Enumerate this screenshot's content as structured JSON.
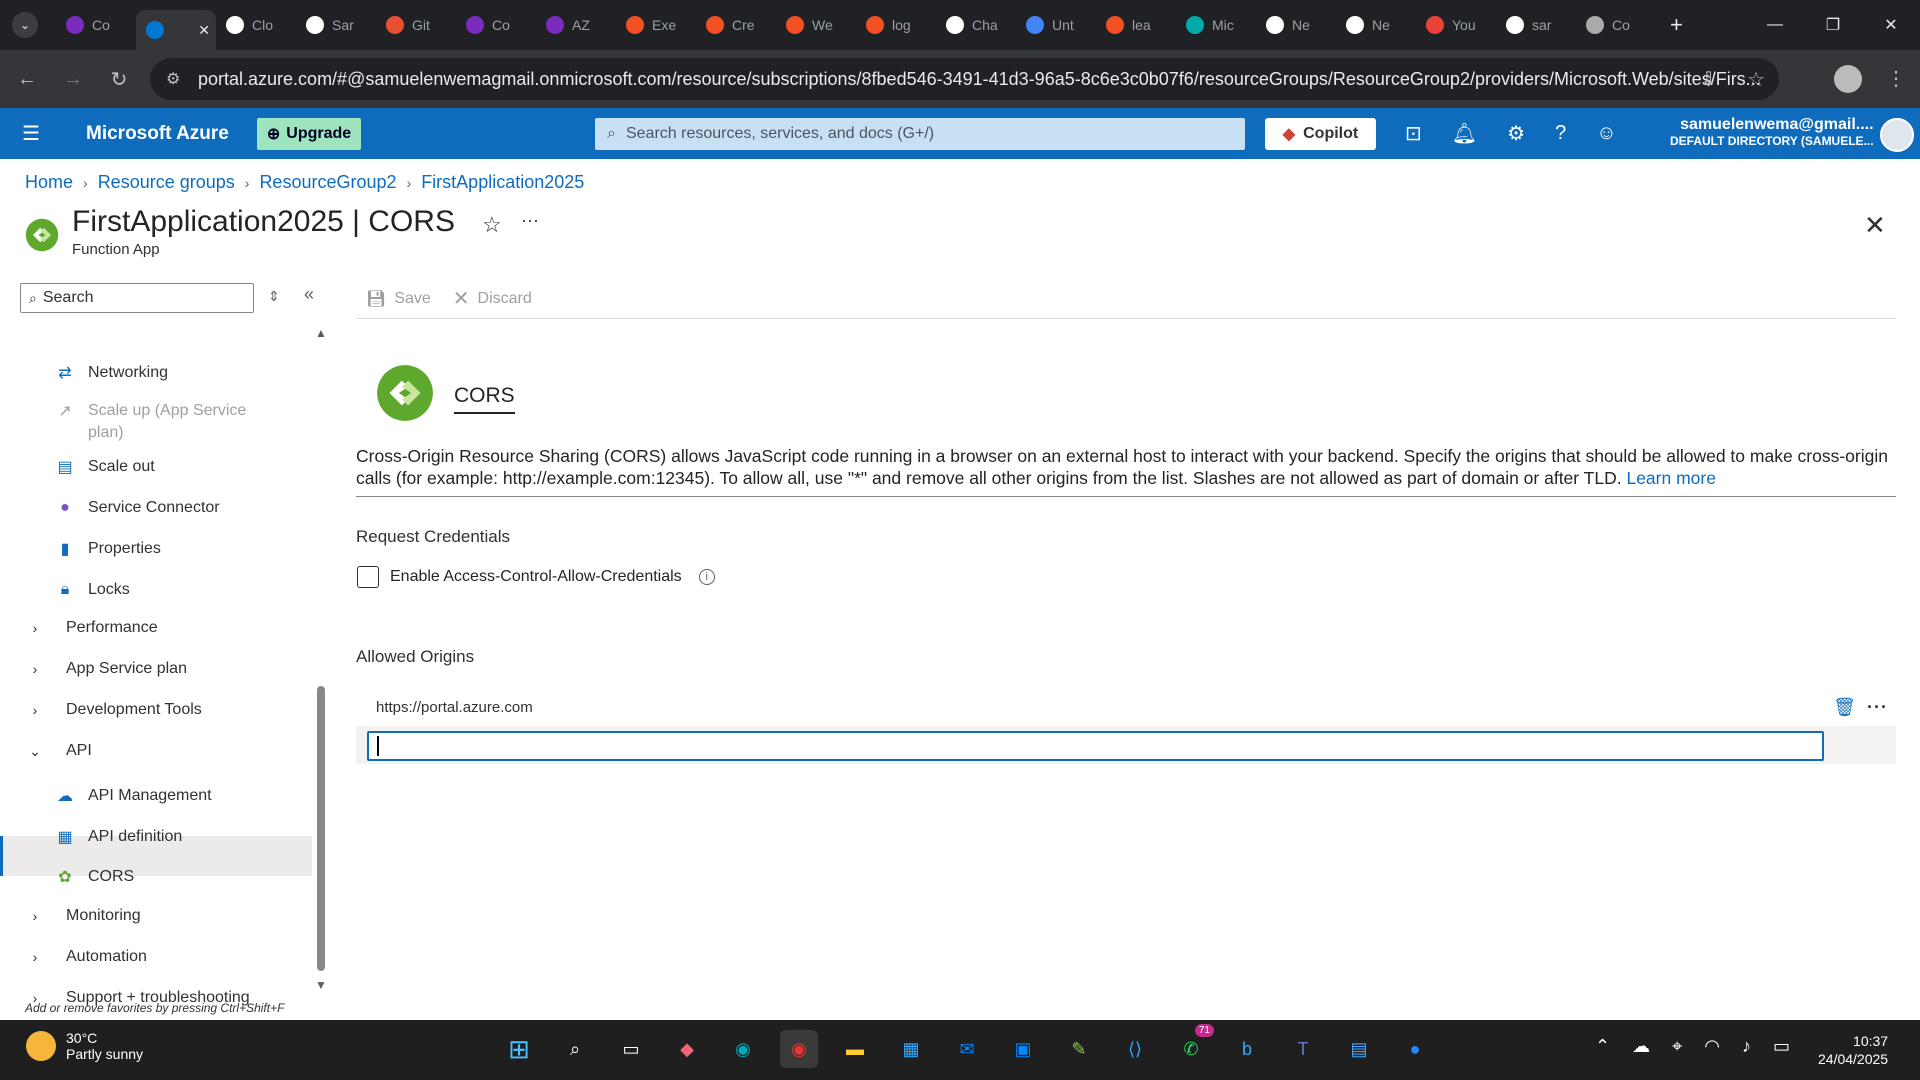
{
  "browser": {
    "tabs": [
      {
        "label": "Co",
        "icon": "u-icon",
        "color": "#7b2cbf"
      },
      {
        "label": "",
        "icon": "azure-icon",
        "color": "#0078d4",
        "active": true
      },
      {
        "label": "Clo",
        "icon": "chatgpt-icon",
        "color": "#fff"
      },
      {
        "label": "Sar",
        "icon": "github-icon",
        "color": "#fff"
      },
      {
        "label": "Git",
        "icon": "git-icon",
        "color": "#e84e31"
      },
      {
        "label": "Co",
        "icon": "u-icon",
        "color": "#7b2cbf"
      },
      {
        "label": "AZ",
        "icon": "u-icon",
        "color": "#7b2cbf"
      },
      {
        "label": "Exe",
        "icon": "microsoft-icon",
        "color": "#f25022"
      },
      {
        "label": "Cre",
        "icon": "microsoft-icon",
        "color": "#f25022"
      },
      {
        "label": "We",
        "icon": "microsoft-icon",
        "color": "#f25022"
      },
      {
        "label": "log",
        "icon": "microsoft-icon",
        "color": "#f25022"
      },
      {
        "label": "Cha",
        "icon": "chatgpt-icon",
        "color": "#fff"
      },
      {
        "label": "Unt",
        "icon": "docs-icon",
        "color": "#4285f4"
      },
      {
        "label": "lea",
        "icon": "microsoft-icon",
        "color": "#f25022"
      },
      {
        "label": "Mic",
        "icon": "c-icon",
        "color": "#0aa"
      },
      {
        "label": "Ne",
        "icon": "notion-icon",
        "color": "#fff"
      },
      {
        "label": "Ne",
        "icon": "notion-icon",
        "color": "#fff"
      },
      {
        "label": "You",
        "icon": "gmail-icon",
        "color": "#ea4335"
      },
      {
        "label": "sar",
        "icon": "google-icon",
        "color": "#fff"
      },
      {
        "label": "Co",
        "icon": "globe-icon",
        "color": "#aaa"
      }
    ],
    "url": "portal.azure.com/#@samuelenwemagmail.onmicrosoft.com/resource/subscriptions/8fbed546-3491-41d3-96a5-8c6e3c0b07f6/resourceGroups/ResourceGroup2/providers/Microsoft.Web/sites/Firs..."
  },
  "azure": {
    "brand": "Microsoft Azure",
    "upgrade": "Upgrade",
    "search_placeholder": "Search resources, services, and docs (G+/)",
    "copilot": "Copilot",
    "account_user": "samuelenwema@gmail....",
    "account_dir": "DEFAULT DIRECTORY (SAMUELE..."
  },
  "breadcrumb": [
    "Home",
    "Resource groups",
    "ResourceGroup2",
    "FirstApplication2025"
  ],
  "page": {
    "title": "FirstApplication2025 | CORS",
    "subtitle": "Function App"
  },
  "sidebar": {
    "search_placeholder": "Search",
    "items": [
      {
        "label": "Networking",
        "icon": "networking-icon",
        "type": "child"
      },
      {
        "label": "Scale up (App Service",
        "label2": "plan)",
        "icon": "scale-up-icon",
        "type": "child",
        "disabled": true
      },
      {
        "label": "Scale out",
        "icon": "scale-out-icon",
        "type": "child"
      },
      {
        "label": "Service Connector",
        "icon": "service-connector-icon",
        "type": "child"
      },
      {
        "label": "Properties",
        "icon": "properties-icon",
        "type": "child"
      },
      {
        "label": "Locks",
        "icon": "lock-icon",
        "type": "child"
      },
      {
        "label": "Performance",
        "type": "group",
        "expanded": false
      },
      {
        "label": "App Service plan",
        "type": "group",
        "expanded": false
      },
      {
        "label": "Development Tools",
        "type": "group",
        "expanded": false
      },
      {
        "label": "API",
        "type": "group",
        "expanded": true
      },
      {
        "label": "API Management",
        "icon": "api-management-icon",
        "type": "child"
      },
      {
        "label": "API definition",
        "icon": "api-definition-icon",
        "type": "child"
      },
      {
        "label": "CORS",
        "icon": "cors-icon",
        "type": "child",
        "selected": true
      },
      {
        "label": "Monitoring",
        "type": "group",
        "expanded": false
      },
      {
        "label": "Automation",
        "type": "group",
        "expanded": false
      },
      {
        "label": "Support + troubleshooting",
        "type": "group",
        "expanded": false
      }
    ],
    "fav_hint": "Add or remove favorites by pressing Ctrl+Shift+F"
  },
  "toolbar": {
    "save": "Save",
    "discard": "Discard"
  },
  "cors": {
    "heading": "CORS",
    "description": "Cross-Origin Resource Sharing (CORS) allows JavaScript code running in a browser on an external host to interact with your backend. Specify the origins that should be allowed to make cross-origin calls (for example: http://example.com:12345). To allow all, use \"*\" and remove all other origins from the list. Slashes are not allowed as part of domain or after TLD.",
    "learn_more": "Learn more",
    "request_credentials": "Request Credentials",
    "enable_credentials": "Enable Access-Control-Allow-Credentials",
    "credentials_checked": false,
    "allowed_origins": "Allowed Origins",
    "origins": [
      "https://portal.azure.com"
    ],
    "new_origin_value": ""
  },
  "taskbar": {
    "temp": "30°C",
    "weather": "Partly sunny",
    "time": "10:37",
    "date": "24/04/2025",
    "whatsapp_badge": "71"
  },
  "colors": {
    "azure_blue": "#0f6cbd",
    "tab_bg": "#202124"
  }
}
